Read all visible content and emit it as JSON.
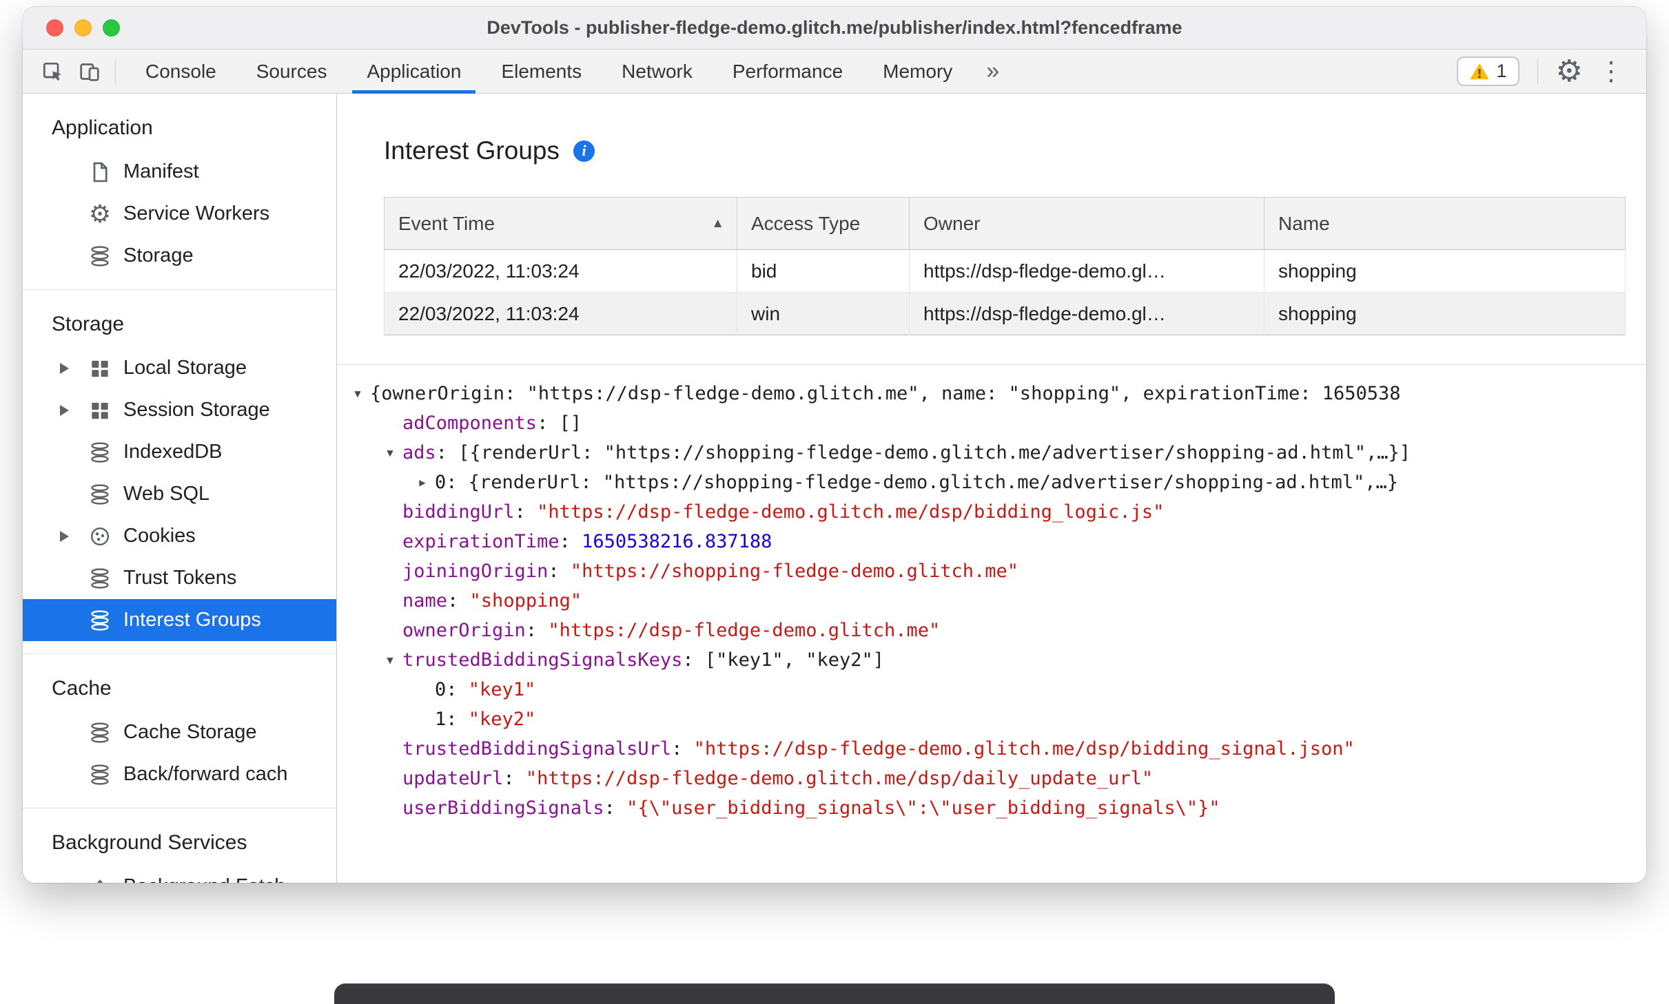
{
  "colors": {
    "accent_blue": "#1a73e8",
    "selection_bg": "#1a73e8",
    "json_key": "#881391",
    "json_string": "#c41a16",
    "json_number": "#1c00cf",
    "warning_yellow": "#fbbc04"
  },
  "icons": {
    "gear": "⚙",
    "kebab": "⋮",
    "more_tabs": "»",
    "sort_asc": "▲",
    "tree_expanded": "▾",
    "tree_collapsed": "▸",
    "info": "i"
  },
  "window": {
    "title": "DevTools - publisher-fledge-demo.glitch.me/publisher/index.html?fencedframe"
  },
  "toolbar": {
    "tabs": [
      {
        "label": "Console",
        "active": false
      },
      {
        "label": "Sources",
        "active": false
      },
      {
        "label": "Application",
        "active": true
      },
      {
        "label": "Elements",
        "active": false
      },
      {
        "label": "Network",
        "active": false
      },
      {
        "label": "Performance",
        "active": false
      },
      {
        "label": "Memory",
        "active": false
      }
    ],
    "warning_count": "1"
  },
  "sidebar": {
    "sections": [
      {
        "header": "Application",
        "items": [
          {
            "icon": "document-icon",
            "label": "Manifest"
          },
          {
            "icon": "gear-icon",
            "label": "Service Workers"
          },
          {
            "icon": "database-icon",
            "label": "Storage"
          }
        ]
      },
      {
        "header": "Storage",
        "items": [
          {
            "icon": "grid-icon",
            "label": "Local Storage",
            "expandable": true
          },
          {
            "icon": "grid-icon",
            "label": "Session Storage",
            "expandable": true
          },
          {
            "icon": "database-icon",
            "label": "IndexedDB"
          },
          {
            "icon": "database-icon",
            "label": "Web SQL"
          },
          {
            "icon": "cookie-icon",
            "label": "Cookies",
            "expandable": true
          },
          {
            "icon": "database-icon",
            "label": "Trust Tokens"
          },
          {
            "icon": "database-icon",
            "label": "Interest Groups",
            "selected": true
          }
        ]
      },
      {
        "header": "Cache",
        "items": [
          {
            "icon": "database-icon",
            "label": "Cache Storage"
          },
          {
            "icon": "database-icon",
            "label": "Back/forward cach"
          }
        ]
      },
      {
        "header": "Background Services",
        "items": [
          {
            "icon": "upload-icon",
            "label": "Background Fetch"
          }
        ]
      }
    ]
  },
  "main": {
    "title": "Interest Groups",
    "table": {
      "columns": [
        "Event Time",
        "Access Type",
        "Owner",
        "Name"
      ],
      "sort": {
        "column": "Event Time",
        "direction": "asc"
      },
      "rows": [
        [
          "22/03/2022, 11:03:24",
          "bid",
          "https://dsp-fledge-demo.gl…",
          "shopping"
        ],
        [
          "22/03/2022, 11:03:24",
          "win",
          "https://dsp-fledge-demo.gl…",
          "shopping"
        ]
      ]
    },
    "tree": {
      "rows": [
        {
          "indent": 0,
          "arrow": "down",
          "parts": [
            {
              "t": "{ownerOrigin: \"https://dsp-fledge-demo.glitch.me\", name: \"shopping\", expirationTime: 1650538",
              "c": "plain"
            }
          ]
        },
        {
          "indent": 1,
          "arrow": "",
          "parts": [
            {
              "t": "adComponents",
              "c": "key"
            },
            {
              "t": ": []",
              "c": "plain"
            }
          ]
        },
        {
          "indent": 1,
          "arrow": "down",
          "parts": [
            {
              "t": "ads",
              "c": "key"
            },
            {
              "t": ": [{renderUrl: \"https://shopping-fledge-demo.glitch.me/advertiser/shopping-ad.html\",…}]",
              "c": "plain"
            }
          ]
        },
        {
          "indent": 2,
          "arrow": "right",
          "parts": [
            {
              "t": "0",
              "c": "index"
            },
            {
              "t": ": {renderUrl: \"https://shopping-fledge-demo.glitch.me/advertiser/shopping-ad.html\",…}",
              "c": "plain"
            }
          ]
        },
        {
          "indent": 1,
          "arrow": "",
          "parts": [
            {
              "t": "biddingUrl",
              "c": "key"
            },
            {
              "t": ": ",
              "c": "plain"
            },
            {
              "t": "\"https://dsp-fledge-demo.glitch.me/dsp/bidding_logic.js\"",
              "c": "string"
            }
          ]
        },
        {
          "indent": 1,
          "arrow": "",
          "parts": [
            {
              "t": "expirationTime",
              "c": "key"
            },
            {
              "t": ": ",
              "c": "plain"
            },
            {
              "t": "1650538216.837188",
              "c": "number"
            }
          ]
        },
        {
          "indent": 1,
          "arrow": "",
          "parts": [
            {
              "t": "joiningOrigin",
              "c": "key"
            },
            {
              "t": ": ",
              "c": "plain"
            },
            {
              "t": "\"https://shopping-fledge-demo.glitch.me\"",
              "c": "string"
            }
          ]
        },
        {
          "indent": 1,
          "arrow": "",
          "parts": [
            {
              "t": "name",
              "c": "key"
            },
            {
              "t": ": ",
              "c": "plain"
            },
            {
              "t": "\"shopping\"",
              "c": "string"
            }
          ]
        },
        {
          "indent": 1,
          "arrow": "",
          "parts": [
            {
              "t": "ownerOrigin",
              "c": "key"
            },
            {
              "t": ": ",
              "c": "plain"
            },
            {
              "t": "\"https://dsp-fledge-demo.glitch.me\"",
              "c": "string"
            }
          ]
        },
        {
          "indent": 1,
          "arrow": "down",
          "parts": [
            {
              "t": "trustedBiddingSignalsKeys",
              "c": "key"
            },
            {
              "t": ": [\"key1\", \"key2\"]",
              "c": "plain"
            }
          ]
        },
        {
          "indent": 2,
          "arrow": "",
          "parts": [
            {
              "t": "0",
              "c": "index"
            },
            {
              "t": ": ",
              "c": "plain"
            },
            {
              "t": "\"key1\"",
              "c": "string"
            }
          ]
        },
        {
          "indent": 2,
          "arrow": "",
          "parts": [
            {
              "t": "1",
              "c": "index"
            },
            {
              "t": ": ",
              "c": "plain"
            },
            {
              "t": "\"key2\"",
              "c": "string"
            }
          ]
        },
        {
          "indent": 1,
          "arrow": "",
          "parts": [
            {
              "t": "trustedBiddingSignalsUrl",
              "c": "key"
            },
            {
              "t": ": ",
              "c": "plain"
            },
            {
              "t": "\"https://dsp-fledge-demo.glitch.me/dsp/bidding_signal.json\"",
              "c": "string"
            }
          ]
        },
        {
          "indent": 1,
          "arrow": "",
          "parts": [
            {
              "t": "updateUrl",
              "c": "key"
            },
            {
              "t": ": ",
              "c": "plain"
            },
            {
              "t": "\"https://dsp-fledge-demo.glitch.me/dsp/daily_update_url\"",
              "c": "string"
            }
          ]
        },
        {
          "indent": 1,
          "arrow": "",
          "parts": [
            {
              "t": "userBiddingSignals",
              "c": "key"
            },
            {
              "t": ": ",
              "c": "plain"
            },
            {
              "t": "\"{\\\"user_bidding_signals\\\":\\\"user_bidding_signals\\\"}\"",
              "c": "string"
            }
          ]
        }
      ]
    }
  }
}
